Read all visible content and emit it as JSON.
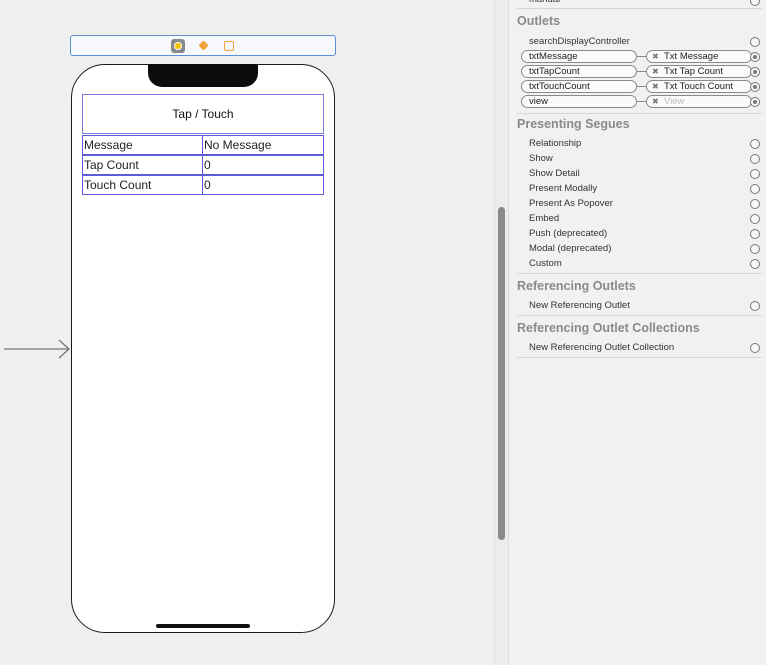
{
  "canvas": {
    "title_label": "Tap / Touch",
    "rows": [
      {
        "key": "Message",
        "value": "No Message"
      },
      {
        "key": "Tap Count",
        "value": "0"
      },
      {
        "key": "Touch Count",
        "value": "0"
      }
    ],
    "dock_icons": [
      "view-controller-icon",
      "first-responder-icon",
      "exit-icon"
    ]
  },
  "inspector": {
    "top_clipped_item": "manual",
    "outlets_title": "Outlets",
    "outlets": [
      {
        "source": "searchDisplayController",
        "connected": false
      },
      {
        "source": "txtMessage",
        "target": "Txt Message",
        "connected": true
      },
      {
        "source": "txtTapCount",
        "target": "Txt Tap Count",
        "connected": true
      },
      {
        "source": "txtTouchCount",
        "target": "Txt Touch Count",
        "connected": true
      },
      {
        "source": "view",
        "target": "View",
        "connected": true,
        "dim": true
      }
    ],
    "segues_title": "Presenting Segues",
    "segues": [
      "Relationship",
      "Show",
      "Show Detail",
      "Present Modally",
      "Present As Popover",
      "Embed",
      "Push (deprecated)",
      "Modal (deprecated)",
      "Custom"
    ],
    "ref_outlets_title": "Referencing Outlets",
    "ref_outlet_item": "New Referencing Outlet",
    "ref_collections_title": "Referencing Outlet Collections",
    "ref_collection_item": "New Referencing Outlet Collection"
  },
  "colors": {
    "selection_blue": "#5c5cd8",
    "dock_accent": "#f3a13b",
    "vc_icon": "#f5c000"
  }
}
